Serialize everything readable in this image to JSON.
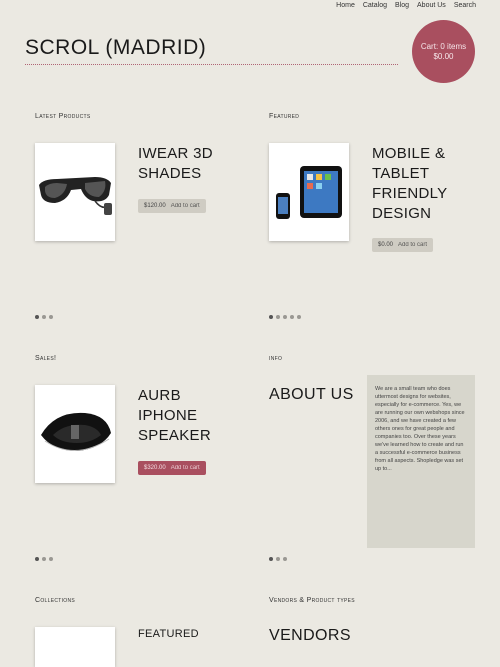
{
  "nav": {
    "items": [
      "Home",
      "Catalog",
      "Blog",
      "About Us",
      "Search"
    ]
  },
  "site": {
    "title": "SCROL (MADRID)"
  },
  "cart": {
    "line1": "Cart: 0 items",
    "line2": "$0.00"
  },
  "latest": {
    "heading": "Latest Products",
    "product": {
      "title": "IWEAR 3D SHADES",
      "price": "$120.00",
      "add": "Add to cart"
    },
    "dots": 3
  },
  "featured": {
    "heading": "Featured",
    "product": {
      "title": "MOBILE & TABLET FRIENDLY DESIGN",
      "price": "$0.00",
      "add": "Add to cart"
    },
    "dots": 5
  },
  "sales": {
    "heading": "Sales!",
    "product": {
      "title": "AURB IPHONE SPEAKER",
      "price": "$320.00",
      "add": "Add to cart"
    },
    "dots": 3
  },
  "info": {
    "heading": "info",
    "title": "ABOUT US",
    "body": "We are a small team who does uttermost designs for websites, especially for e-commerce. Yes, we are running our own webshops since 2006, and we have created a few others ones for great people and companies too. Over these years we've learned how to create and run a successful e-commerce business from all aspects. Shopledge was set up to...",
    "dots": 3
  },
  "collections": {
    "heading": "Collections",
    "featured_label": "FEATURED"
  },
  "vendors": {
    "heading": "Vendors & Product types",
    "title": "VENDORS"
  }
}
